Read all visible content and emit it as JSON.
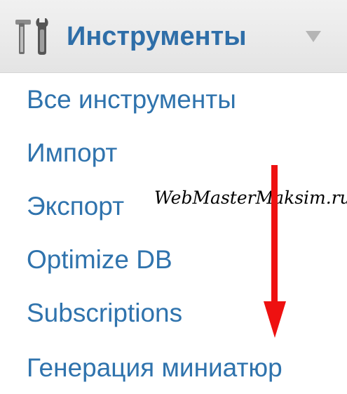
{
  "menu": {
    "title": "Инструменты",
    "icon": "tools-icon",
    "items": [
      {
        "label": "Все инструменты"
      },
      {
        "label": "Импорт"
      },
      {
        "label": "Экспорт"
      },
      {
        "label": "Optimize DB"
      },
      {
        "label": "Subscriptions"
      },
      {
        "label": "Генерация миниатюр"
      }
    ]
  },
  "watermark": {
    "text": "WebMasterMaksim.ru"
  },
  "colors": {
    "link": "#2f73ad",
    "title": "#2e6ea8",
    "header_bg": "#e9e9e9",
    "arrow": "#ee1111"
  }
}
